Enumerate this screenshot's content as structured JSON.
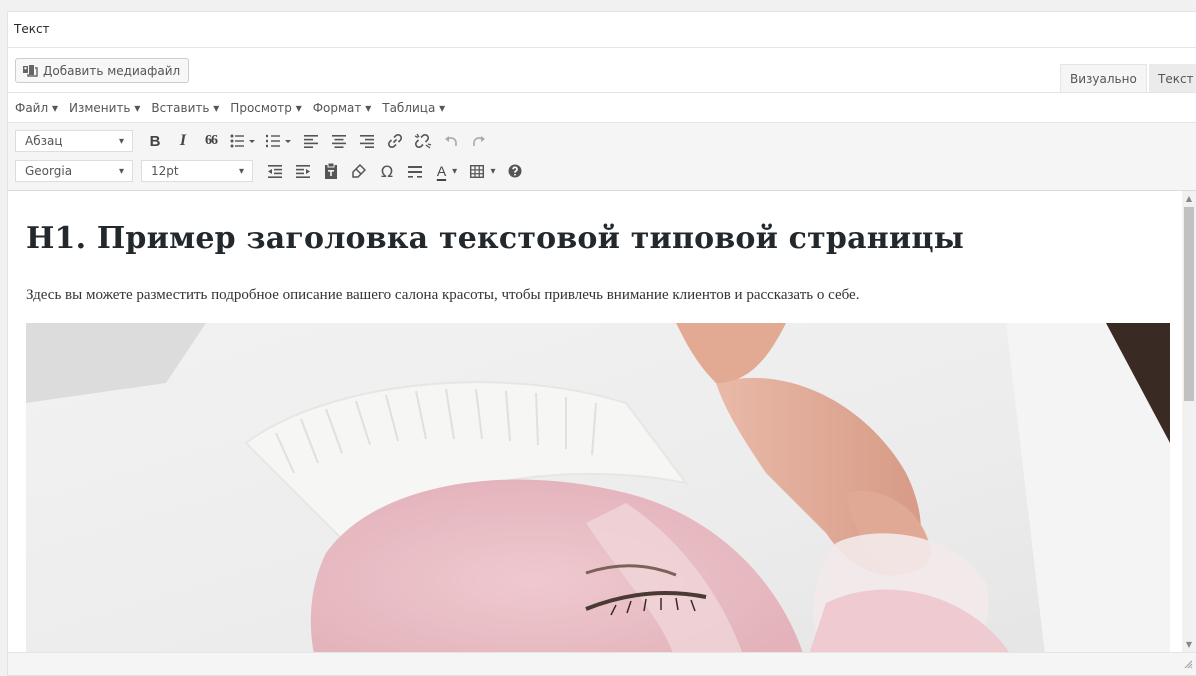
{
  "box": {
    "title": "Текст"
  },
  "media": {
    "button_label": "Добавить медиафайл",
    "icon": "media-icon"
  },
  "tabs": [
    {
      "label": "Визуально"
    },
    {
      "label": "Текст"
    }
  ],
  "menubar": [
    {
      "label": "Файл ▾"
    },
    {
      "label": "Изменить ▾"
    },
    {
      "label": "Вставить ▾"
    },
    {
      "label": "Просмотр ▾"
    },
    {
      "label": "Формат ▾"
    },
    {
      "label": "Таблица ▾"
    }
  ],
  "toolbar": {
    "format_select": {
      "value": "Абзац"
    },
    "font_select": {
      "value": "Georgia"
    },
    "size_select": {
      "value": "12pt"
    },
    "row1_icons": [
      "bold-icon",
      "italic-icon",
      "blockquote-icon",
      "bullet-list-icon",
      "numbered-list-icon",
      "align-left-icon",
      "align-center-icon",
      "align-right-icon",
      "link-icon",
      "unlink-icon",
      "undo-icon",
      "redo-icon"
    ],
    "row2_icons": [
      "outdent-icon",
      "indent-icon",
      "paste-text-icon",
      "clear-formatting-icon",
      "special-character-icon",
      "horizontal-line-icon",
      "text-color-icon",
      "table-icon",
      "help-icon"
    ],
    "bold_glyph": "B",
    "italic_glyph": "I",
    "quote_glyph": "66",
    "omega_glyph": "Ω",
    "text_color_glyph": "A",
    "dropdown_glyph": "▾"
  },
  "content": {
    "heading": "H1. Пример заголовка текстовой типовой страницы",
    "paragraph": "Здесь вы можете разместить подробное описание вашего салона красоты, чтобы привлечь внимание клиентов и рассказать о себе.",
    "image": "face-mask-photo"
  },
  "colors": {
    "accent": "#555555",
    "background": "#f1f1f1",
    "toolbar": "#f5f5f5"
  }
}
